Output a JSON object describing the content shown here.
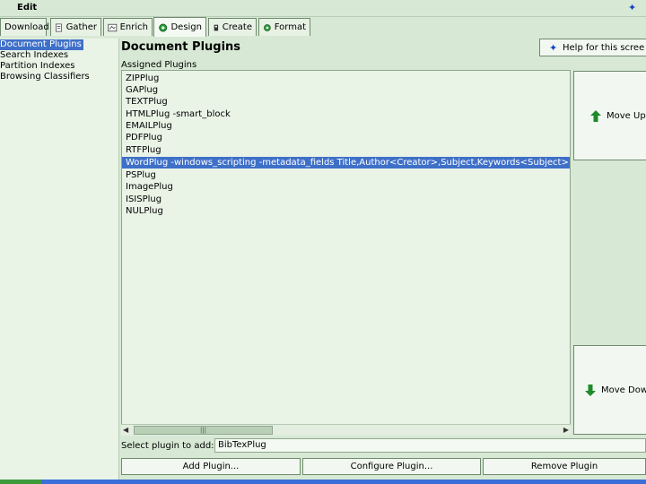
{
  "menu": {
    "edit_label": "Edit"
  },
  "tabs": [
    {
      "label": "Download",
      "icon": "download-icon"
    },
    {
      "label": "Gather",
      "icon": "gather-icon"
    },
    {
      "label": "Enrich",
      "icon": "enrich-icon"
    },
    {
      "label": "Design",
      "icon": "gear-icon",
      "active": true
    },
    {
      "label": "Create",
      "icon": "create-icon"
    },
    {
      "label": "Format",
      "icon": "gear-icon"
    }
  ],
  "tree": {
    "items": [
      {
        "label": "Document Plugins",
        "selected": true
      },
      {
        "label": "Search Indexes"
      },
      {
        "label": "Partition Indexes"
      },
      {
        "label": "Browsing Classifiers"
      }
    ]
  },
  "main": {
    "title": "Document Plugins",
    "help_label": "Help for this scree",
    "assigned_label": "Assigned Plugins",
    "plugins": [
      "ZIPPlug",
      "GAPlug",
      "TEXTPlug",
      "HTMLPlug -smart_block",
      "EMAILPlug",
      "PDFPlug",
      "RTFPlug",
      "WordPlug -windows_scripting -metadata_fields Title,Author<Creator>,Subject,Keywords<Subject>",
      "PSPlug",
      "ImagePlug",
      "ISISPlug",
      "NULPlug"
    ],
    "selected_plugin_index": 7,
    "scroll_thumb_glyph": "|||",
    "move_up_label": "Move Up",
    "move_down_label": "Move Dow",
    "select_label": "Select plugin to add:",
    "select_value": "BibTexPlug",
    "add_label": "Add Plugin...",
    "configure_label": "Configure Plugin...",
    "remove_label": "Remove Plugin"
  },
  "colors": {
    "background": "#d7e9d5",
    "selection": "#3f70c8",
    "arrow_green": "#1f8a2a",
    "help_icon": "#1540c8"
  }
}
